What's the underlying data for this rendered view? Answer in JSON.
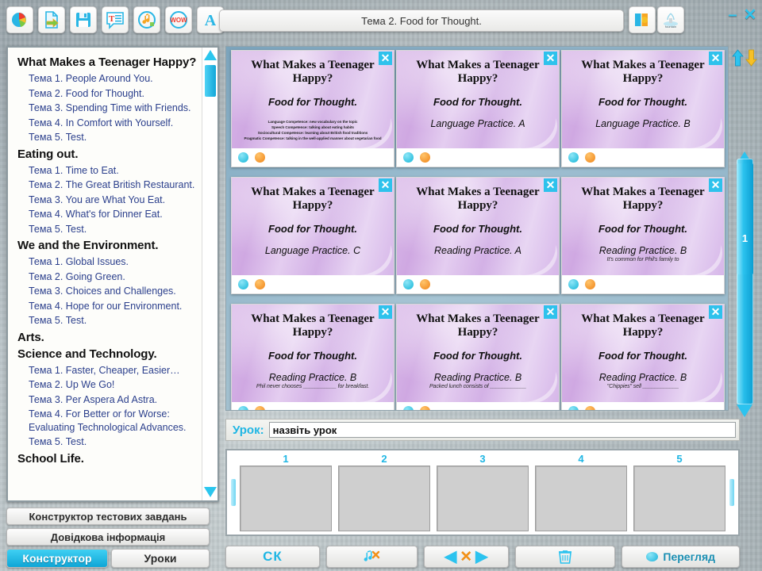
{
  "window": {
    "title": "Тема 2. Food for Thought.",
    "minimize_label": "–",
    "close_label": "✕"
  },
  "toolbar": {
    "icons": [
      {
        "name": "pie-chart-icon",
        "label": "Діаграма"
      },
      {
        "name": "document-export-icon",
        "label": "Документ"
      },
      {
        "name": "save-floppy-icon",
        "label": "Зберегти"
      },
      {
        "name": "text-balloon-icon",
        "label": "Текст"
      },
      {
        "name": "music-note-icon",
        "label": "Музика"
      },
      {
        "name": "wow-badge-icon",
        "label": "WOW"
      },
      {
        "name": "letter-a-icon",
        "label": "A"
      }
    ],
    "right_icons": [
      {
        "name": "book-open-icon",
        "label": "Книга"
      },
      {
        "name": "fountain-icon",
        "label": "Фонтан"
      }
    ]
  },
  "sidebar": {
    "sections": [
      {
        "heading": "What Makes a Teenager Happy?",
        "items": [
          "Тема 1. People Around You.",
          "Тема 2. Food for Thought.",
          "Тема 3. Spending Time with Friends.",
          "Тема 4. In Comfort with Yourself.",
          "Тема 5. Test."
        ]
      },
      {
        "heading": "Eating out.",
        "items": [
          "Тема 1. Time to Eat.",
          "Тема 2. The Great British Restaurant.",
          "Тема 3. You are What You Eat.",
          "Тема 4. What's for Dinner Eat.",
          "Тема 5. Test."
        ]
      },
      {
        "heading": "We and the Environment.",
        "items": [
          "Тема 1. Global Issues.",
          "Тема 2. Going Green.",
          "Тема 3. Choices and Challenges.",
          "Тема 4. Hope for our Environment.",
          "Тема 5. Test."
        ]
      },
      {
        "heading": "Arts.",
        "items": []
      },
      {
        "heading": "Science and Technology.",
        "items": [
          "Тема 1. Faster, Cheaper, Easier…",
          "Тема 2. Up We Go!",
          "Тема 3. Per Aspera Ad Astra.",
          "Тема 4. For Better or for Worse: Evaluating Technological Advances.",
          "Тема 5. Test."
        ]
      },
      {
        "heading": "School Life.",
        "items": []
      }
    ],
    "buttons": {
      "constructor_tests": "Конструктор тестових завдань",
      "reference_info": "Довідкова інформація"
    },
    "tabs": [
      {
        "label": "Конструктор",
        "active": true
      },
      {
        "label": "Уроки",
        "active": false
      }
    ]
  },
  "cards": [
    {
      "title": "What Makes a Teenager Happy?",
      "subtitle": "Food for Thought.",
      "practice": "",
      "note": "",
      "competences": [
        "Language Competence: new vocabulary on the topic",
        "Speech Competence: talking about eating habits",
        "Sociocultural Competence: learning about British food traditions",
        "Pragmatic Competence: talking in the well-applied manner about vegetarian food"
      ],
      "close": "✕"
    },
    {
      "title": "What Makes a Teenager Happy?",
      "subtitle": "Food for Thought.",
      "practice": "Language Practice. A",
      "note": "",
      "competences": [],
      "close": "✕"
    },
    {
      "title": "What Makes a Teenager Happy?",
      "subtitle": "Food for Thought.",
      "practice": "Language Practice. B",
      "note": "",
      "competences": [],
      "close": "✕"
    },
    {
      "title": "What Makes a Teenager Happy?",
      "subtitle": "Food for Thought.",
      "practice": "Language Practice. C",
      "note": "",
      "competences": [],
      "close": "✕"
    },
    {
      "title": "What Makes a Teenager Happy?",
      "subtitle": "Food for Thought.",
      "practice": "Reading Practice. A",
      "note": "",
      "competences": [],
      "close": "✕"
    },
    {
      "title": "What Makes a Teenager Happy?",
      "subtitle": "Food for Thought.",
      "practice": "Reading Practice. B",
      "note": "It's common for Phil's family to",
      "competences": [],
      "close": "✕"
    },
    {
      "title": "What Makes a Teenager Happy?",
      "subtitle": "Food for Thought.",
      "practice": "Reading Practice. B",
      "note": "Phil never chooses ___________ for breakfast.",
      "competences": [],
      "close": "✕"
    },
    {
      "title": "What Makes a Teenager Happy?",
      "subtitle": "Food for Thought.",
      "practice": "Reading Practice. B",
      "note": "Packed lunch consists of ____________",
      "competences": [],
      "close": "✕"
    },
    {
      "title": "What Makes a Teenager Happy?",
      "subtitle": "Food for Thought.",
      "practice": "Reading Practice. B",
      "note": "\"Chippies\" sell ____________",
      "competences": [],
      "close": "✕"
    }
  ],
  "right_rail": {
    "up_arrow": "up-arrow-icon",
    "down_arrow": "down-arrow-icon",
    "slider_value": "1"
  },
  "lesson": {
    "label": "Урок:",
    "value": "назвіть урок",
    "placeholder": "назвіть урок"
  },
  "slide_strip": {
    "slides": [
      "1",
      "2",
      "3",
      "4",
      "5"
    ]
  },
  "bottom_bar": {
    "sk_label": "СК",
    "music_label": "",
    "prev_label": "◀",
    "delete_label": "✕",
    "next_label": "▶",
    "trash_label": "",
    "preview_label": "Перегляд"
  },
  "colors": {
    "accent_cyan": "#2ec2ec",
    "accent_orange": "#f08417",
    "card_purple": "#d3b1e6",
    "link_blue": "#2b3f8c"
  }
}
